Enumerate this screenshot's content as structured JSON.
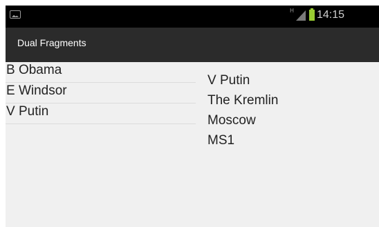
{
  "status_bar": {
    "network_type": "H",
    "time": "14:15",
    "notification_icon": "image-icon",
    "signal_icon": "signal-icon",
    "battery_icon": "battery-icon",
    "battery_color": "#9acd32"
  },
  "action_bar": {
    "title": "Dual Fragments"
  },
  "list": {
    "items": [
      "B Obama",
      "E Windsor",
      "V Putin"
    ]
  },
  "details": {
    "lines": [
      "V Putin",
      "The Kremlin",
      "Moscow",
      "MS1"
    ]
  },
  "colors": {
    "status_bar_bg": "#000000",
    "action_bar_bg": "#2b2b2b",
    "content_bg": "#f0f0f0"
  }
}
